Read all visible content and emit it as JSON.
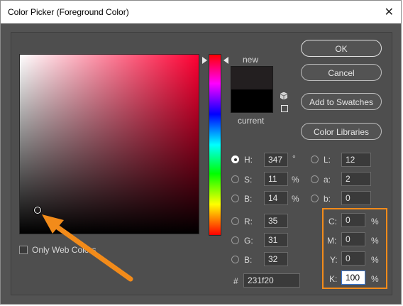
{
  "window": {
    "title": "Color Picker (Foreground Color)",
    "close_glyph": "✕"
  },
  "swatch": {
    "new_label": "new",
    "current_label": "current",
    "new_color": "#231f20",
    "current_color": "#000000"
  },
  "buttons": {
    "ok": "OK",
    "cancel": "Cancel",
    "add_swatches": "Add to Swatches",
    "color_libraries": "Color Libraries"
  },
  "hsb": {
    "h_label": "H:",
    "h_value": "347",
    "h_unit": "°",
    "s_label": "S:",
    "s_value": "11",
    "s_unit": "%",
    "b_label": "B:",
    "b_value": "14",
    "b_unit": "%"
  },
  "lab": {
    "l_label": "L:",
    "l_value": "12",
    "a_label": "a:",
    "a_value": "2",
    "b_label": "b:",
    "b_value": "0"
  },
  "rgb": {
    "r_label": "R:",
    "r_value": "35",
    "g_label": "G:",
    "g_value": "31",
    "b_label": "B:",
    "b_value": "32"
  },
  "hex": {
    "label": "#",
    "value": "231f20"
  },
  "cmyk": {
    "c_label": "C:",
    "c_value": "0",
    "c_unit": "%",
    "m_label": "M:",
    "m_value": "0",
    "m_unit": "%",
    "y_label": "Y:",
    "y_value": "0",
    "y_unit": "%",
    "k_label": "K:",
    "k_value": "100",
    "k_unit": "%"
  },
  "web_colors": {
    "label": "Only Web Colors",
    "checked": false
  },
  "annotation_color": "#f28b1a"
}
